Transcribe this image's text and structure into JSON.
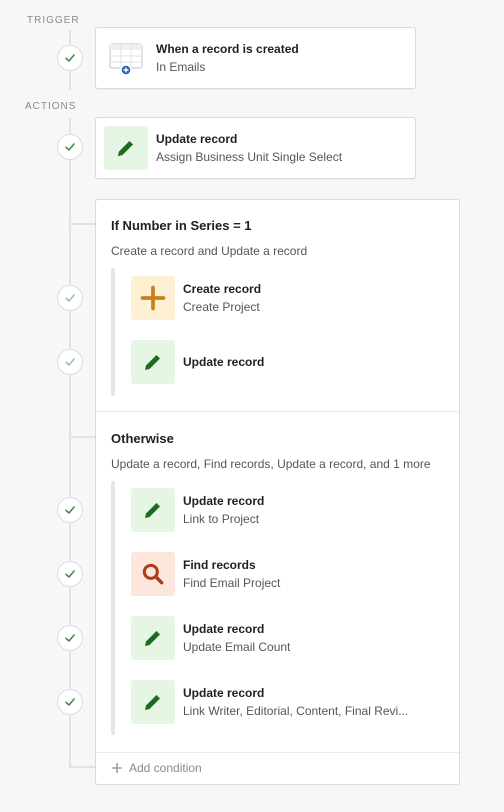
{
  "trigger": {
    "section_label": "TRIGGER",
    "title": "When a record is created",
    "subtitle": "In Emails",
    "icon": "table-add-icon"
  },
  "actions": {
    "section_label": "ACTIONS",
    "first": {
      "title": "Update record",
      "subtitle": "Assign Business Unit Single Select",
      "icon": "pencil-icon"
    }
  },
  "branch_if": {
    "title": "If Number in Series = 1",
    "description": "Create a record and Update a record",
    "steps": [
      {
        "title": "Create record",
        "subtitle": "Create Project",
        "icon": "plus-icon",
        "color": "#c7831a"
      },
      {
        "title": "Update record",
        "subtitle": "",
        "icon": "pencil-icon",
        "color": "#1e6b1f"
      }
    ]
  },
  "branch_else": {
    "title": "Otherwise",
    "description": "Update a record, Find records, Update a record, and 1 more",
    "steps": [
      {
        "title": "Update record",
        "subtitle": "Link to Project",
        "icon": "pencil-icon",
        "color": "#1e6b1f"
      },
      {
        "title": "Find records",
        "subtitle": "Find Email Project",
        "icon": "search-icon",
        "color": "#b23a14"
      },
      {
        "title": "Update record",
        "subtitle": "Update Email Count",
        "icon": "pencil-icon",
        "color": "#1e6b1f"
      },
      {
        "title": "Update record",
        "subtitle": "Link Writer, Editorial, Content, Final Revi...",
        "icon": "pencil-icon",
        "color": "#1e6b1f"
      }
    ]
  },
  "add_condition_label": "Add condition",
  "colors": {
    "check": "#3f8f4a",
    "pencil": "#1e6b1f",
    "plus": "#c7831a",
    "search": "#b23a14"
  }
}
